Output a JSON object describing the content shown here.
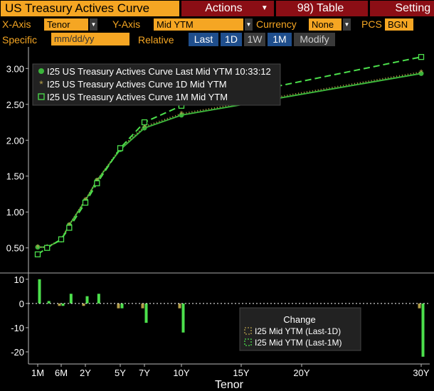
{
  "window": {
    "title": "US Treasury Actives Curve",
    "actions_label": "Actions",
    "table_label": "98) Table",
    "settings_label": "Setting"
  },
  "controls": {
    "xaxis_label": "X-Axis",
    "xaxis_value": "Tenor",
    "yaxis_label": "Y-Axis",
    "yaxis_value": "Mid YTM",
    "currency_label": "Currency",
    "currency_value": "None",
    "pcs_label": "PCS",
    "pcs_value": "BGN",
    "specific_label": "Specific",
    "date_placeholder": "mm/dd/yy",
    "relative_label": "Relative",
    "buttons": [
      "Last",
      "1D",
      "1W",
      "1M",
      "Modify"
    ]
  },
  "colors": {
    "accent": "#f5a623",
    "header_red": "#8b0e15",
    "last_series": "#3bb53b",
    "day_series": "#b5a04a",
    "month_series": "#4ce04c",
    "active_button": "#1f4e8c"
  },
  "chart_data": [
    {
      "type": "line",
      "x": [
        1,
        3,
        6,
        12,
        24,
        36,
        60,
        84,
        120,
        360
      ],
      "xlabel": "Tenor",
      "xtick_labels": [
        "1M",
        "6M",
        "2Y",
        "5Y",
        "7Y",
        "10Y",
        "15Y",
        "20Y",
        "30Y"
      ],
      "xtick_values": [
        1,
        6,
        24,
        60,
        84,
        120,
        180,
        240,
        360
      ],
      "yticks": [
        0.5,
        1.0,
        1.5,
        2.0,
        2.5,
        3.0
      ],
      "ytick_labels": [
        "0.50",
        "1.00",
        "1.50",
        "2.00",
        "2.50",
        "3.00"
      ],
      "ylim": [
        0.18,
        3.3
      ],
      "legend_position": "top-left",
      "series": [
        {
          "name": "I25 US Treasury Actives Curve Last Mid YTM 10:33:12",
          "marker": "dot",
          "values": [
            0.51,
            0.51,
            0.61,
            0.82,
            1.16,
            1.44,
            1.87,
            2.17,
            2.35,
            2.93
          ]
        },
        {
          "name": "I25 US Treasury Actives Curve 1D Mid YTM",
          "marker": "star",
          "values": [
            0.51,
            0.51,
            0.62,
            0.82,
            1.17,
            1.44,
            1.89,
            2.19,
            2.37,
            2.95
          ]
        },
        {
          "name": "I25 US Treasury Actives Curve 1M Mid YTM",
          "marker": "square",
          "values": [
            0.41,
            0.5,
            0.62,
            0.78,
            1.13,
            1.4,
            1.89,
            2.25,
            2.48,
            3.16
          ]
        }
      ]
    },
    {
      "type": "bar",
      "x": [
        1,
        3,
        6,
        12,
        24,
        36,
        60,
        84,
        120,
        360
      ],
      "yticks": [
        10,
        0,
        -10,
        -20
      ],
      "ylim": [
        -25,
        12
      ],
      "legend_title": "Change",
      "legend_position": "bottom-right",
      "series": [
        {
          "name": "I25 Mid YTM (Last-1D)",
          "values": [
            0,
            0,
            -1,
            0,
            -1,
            0,
            -2,
            -2,
            -2,
            -2
          ]
        },
        {
          "name": "I25 Mid YTM (Last-1M)",
          "values": [
            10,
            1,
            -1,
            4,
            3,
            4,
            -2,
            -8,
            -12,
            -22
          ]
        }
      ]
    }
  ]
}
